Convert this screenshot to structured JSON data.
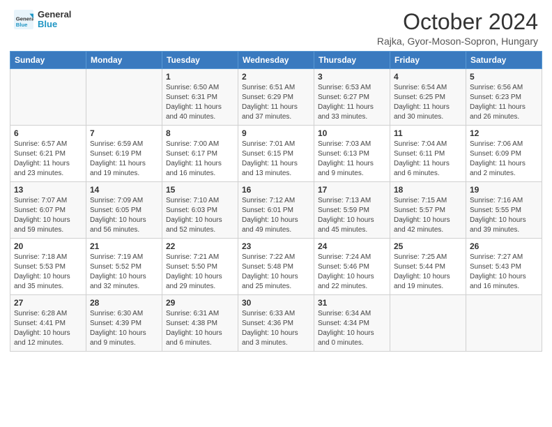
{
  "logo": {
    "line1": "General",
    "line2": "Blue"
  },
  "title": "October 2024",
  "subtitle": "Rajka, Gyor-Moson-Sopron, Hungary",
  "weekdays": [
    "Sunday",
    "Monday",
    "Tuesday",
    "Wednesday",
    "Thursday",
    "Friday",
    "Saturday"
  ],
  "weeks": [
    [
      {
        "day": null
      },
      {
        "day": null
      },
      {
        "day": 1,
        "sunrise": "6:50 AM",
        "sunset": "6:31 PM",
        "daylight": "11 hours and 40 minutes."
      },
      {
        "day": 2,
        "sunrise": "6:51 AM",
        "sunset": "6:29 PM",
        "daylight": "11 hours and 37 minutes."
      },
      {
        "day": 3,
        "sunrise": "6:53 AM",
        "sunset": "6:27 PM",
        "daylight": "11 hours and 33 minutes."
      },
      {
        "day": 4,
        "sunrise": "6:54 AM",
        "sunset": "6:25 PM",
        "daylight": "11 hours and 30 minutes."
      },
      {
        "day": 5,
        "sunrise": "6:56 AM",
        "sunset": "6:23 PM",
        "daylight": "11 hours and 26 minutes."
      }
    ],
    [
      {
        "day": 6,
        "sunrise": "6:57 AM",
        "sunset": "6:21 PM",
        "daylight": "11 hours and 23 minutes."
      },
      {
        "day": 7,
        "sunrise": "6:59 AM",
        "sunset": "6:19 PM",
        "daylight": "11 hours and 19 minutes."
      },
      {
        "day": 8,
        "sunrise": "7:00 AM",
        "sunset": "6:17 PM",
        "daylight": "11 hours and 16 minutes."
      },
      {
        "day": 9,
        "sunrise": "7:01 AM",
        "sunset": "6:15 PM",
        "daylight": "11 hours and 13 minutes."
      },
      {
        "day": 10,
        "sunrise": "7:03 AM",
        "sunset": "6:13 PM",
        "daylight": "11 hours and 9 minutes."
      },
      {
        "day": 11,
        "sunrise": "7:04 AM",
        "sunset": "6:11 PM",
        "daylight": "11 hours and 6 minutes."
      },
      {
        "day": 12,
        "sunrise": "7:06 AM",
        "sunset": "6:09 PM",
        "daylight": "11 hours and 2 minutes."
      }
    ],
    [
      {
        "day": 13,
        "sunrise": "7:07 AM",
        "sunset": "6:07 PM",
        "daylight": "10 hours and 59 minutes."
      },
      {
        "day": 14,
        "sunrise": "7:09 AM",
        "sunset": "6:05 PM",
        "daylight": "10 hours and 56 minutes."
      },
      {
        "day": 15,
        "sunrise": "7:10 AM",
        "sunset": "6:03 PM",
        "daylight": "10 hours and 52 minutes."
      },
      {
        "day": 16,
        "sunrise": "7:12 AM",
        "sunset": "6:01 PM",
        "daylight": "10 hours and 49 minutes."
      },
      {
        "day": 17,
        "sunrise": "7:13 AM",
        "sunset": "5:59 PM",
        "daylight": "10 hours and 45 minutes."
      },
      {
        "day": 18,
        "sunrise": "7:15 AM",
        "sunset": "5:57 PM",
        "daylight": "10 hours and 42 minutes."
      },
      {
        "day": 19,
        "sunrise": "7:16 AM",
        "sunset": "5:55 PM",
        "daylight": "10 hours and 39 minutes."
      }
    ],
    [
      {
        "day": 20,
        "sunrise": "7:18 AM",
        "sunset": "5:53 PM",
        "daylight": "10 hours and 35 minutes."
      },
      {
        "day": 21,
        "sunrise": "7:19 AM",
        "sunset": "5:52 PM",
        "daylight": "10 hours and 32 minutes."
      },
      {
        "day": 22,
        "sunrise": "7:21 AM",
        "sunset": "5:50 PM",
        "daylight": "10 hours and 29 minutes."
      },
      {
        "day": 23,
        "sunrise": "7:22 AM",
        "sunset": "5:48 PM",
        "daylight": "10 hours and 25 minutes."
      },
      {
        "day": 24,
        "sunrise": "7:24 AM",
        "sunset": "5:46 PM",
        "daylight": "10 hours and 22 minutes."
      },
      {
        "day": 25,
        "sunrise": "7:25 AM",
        "sunset": "5:44 PM",
        "daylight": "10 hours and 19 minutes."
      },
      {
        "day": 26,
        "sunrise": "7:27 AM",
        "sunset": "5:43 PM",
        "daylight": "10 hours and 16 minutes."
      }
    ],
    [
      {
        "day": 27,
        "sunrise": "6:28 AM",
        "sunset": "4:41 PM",
        "daylight": "10 hours and 12 minutes."
      },
      {
        "day": 28,
        "sunrise": "6:30 AM",
        "sunset": "4:39 PM",
        "daylight": "10 hours and 9 minutes."
      },
      {
        "day": 29,
        "sunrise": "6:31 AM",
        "sunset": "4:38 PM",
        "daylight": "10 hours and 6 minutes."
      },
      {
        "day": 30,
        "sunrise": "6:33 AM",
        "sunset": "4:36 PM",
        "daylight": "10 hours and 3 minutes."
      },
      {
        "day": 31,
        "sunrise": "6:34 AM",
        "sunset": "4:34 PM",
        "daylight": "10 hours and 0 minutes."
      },
      {
        "day": null
      },
      {
        "day": null
      }
    ]
  ]
}
